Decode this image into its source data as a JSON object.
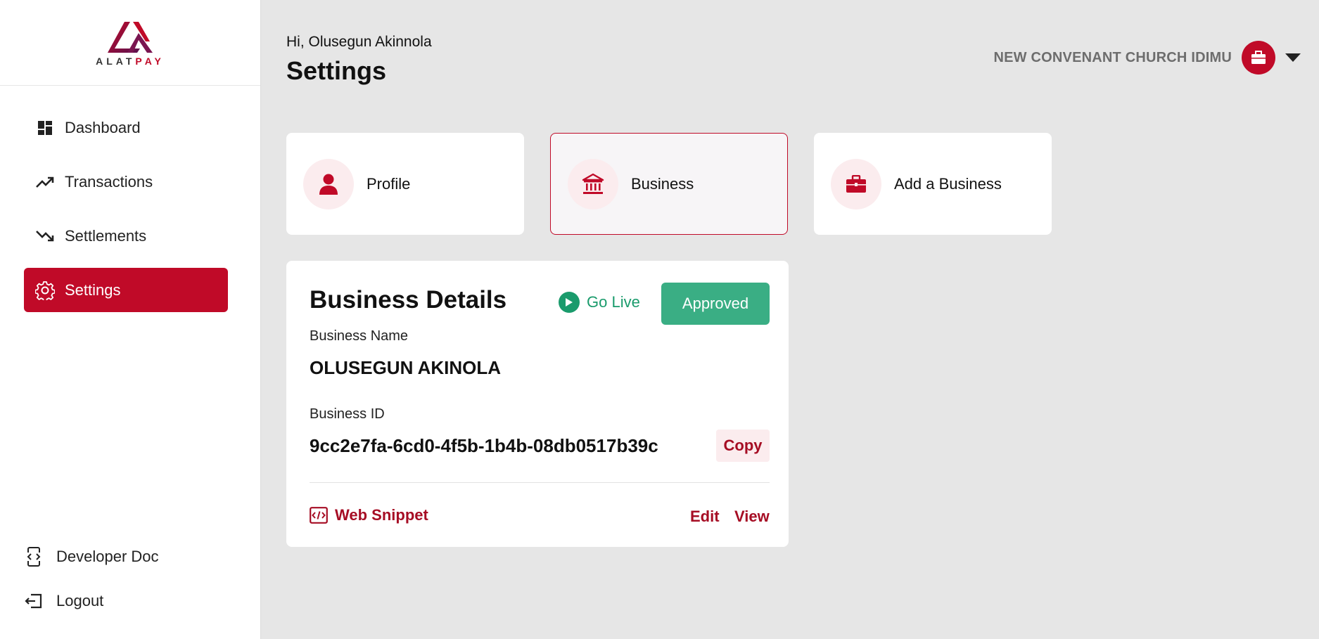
{
  "brand": {
    "logo_left": "ALAT",
    "logo_right": "PAY",
    "accent": "#c00a28"
  },
  "sidebar": {
    "items": [
      {
        "label": "Dashboard",
        "icon": "dashboard-icon"
      },
      {
        "label": "Transactions",
        "icon": "trending-up-icon"
      },
      {
        "label": "Settlements",
        "icon": "trending-down-icon"
      },
      {
        "label": "Settings",
        "icon": "gear-icon",
        "active": true
      }
    ],
    "bottom": [
      {
        "label": "Developer Doc",
        "icon": "developer-doc-icon"
      },
      {
        "label": "Logout",
        "icon": "logout-icon"
      }
    ]
  },
  "header": {
    "greeting": "Hi, Olusegun Akinnola",
    "title": "Settings",
    "org_name": "NEW CONVENANT CHURCH IDIMU",
    "org_icon": "briefcase-icon"
  },
  "tabs": [
    {
      "label": "Profile",
      "icon": "person-icon"
    },
    {
      "label": "Business",
      "icon": "bank-icon",
      "selected": true
    },
    {
      "label": "Add a Business",
      "icon": "briefcase-icon"
    }
  ],
  "business": {
    "title": "Business Details",
    "go_live": "Go Live",
    "status": "Approved",
    "name_label": "Business Name",
    "name_value": "OLUSEGUN AKINOLA",
    "id_label": "Business ID",
    "id_value": "9cc2e7fa-6cd0-4f5b-1b4b-08db0517b39c",
    "copy_label": "Copy",
    "snippet_label": "Web Snippet",
    "edit_label": "Edit",
    "view_label": "View"
  }
}
